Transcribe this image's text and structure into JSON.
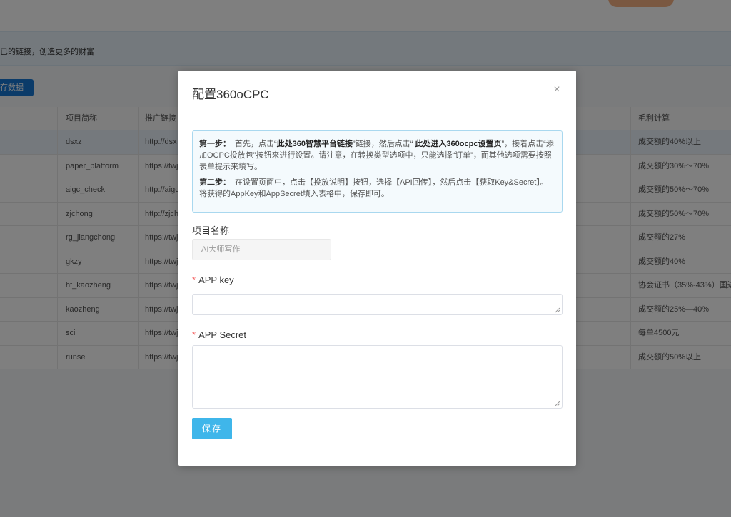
{
  "background": {
    "banner_text": "已的链接，创造更多的财富",
    "save_data_label": "存数据",
    "table": {
      "headers": [
        "项目简称",
        "推广链接",
        "毛利计算"
      ],
      "rows": [
        {
          "name": "dsxz",
          "link": "http://dsx",
          "profit": "成交额的40%以上"
        },
        {
          "name": "paper_platform",
          "link": "https://twj",
          "profit": "成交额的30%～70%"
        },
        {
          "name": "aigc_check",
          "link": "http://aigc",
          "profit": "成交额的50%～70%"
        },
        {
          "name": "zjchong",
          "link": "http://zjch",
          "profit": "成交额的50%～70%"
        },
        {
          "name": "rg_jiangchong",
          "link": "https://twj",
          "profit": "成交额的27%"
        },
        {
          "name": "gkzy",
          "link": "https://twj",
          "profit": "成交额的40%"
        },
        {
          "name": "ht_kaozheng",
          "link": "https://twj",
          "profit": "协会证书（35%-43%）国进"
        },
        {
          "name": "kaozheng",
          "link": "https://twj",
          "profit": "成交额的25%—40%"
        },
        {
          "name": "sci",
          "link": "https://twj",
          "profit": "每单4500元"
        },
        {
          "name": "runse",
          "link": "https://twj",
          "profit": "成交额的50%以上"
        }
      ]
    }
  },
  "modal": {
    "title": "配置360oCPC",
    "close_icon": "×",
    "notice": {
      "step1_label": "第一步：",
      "step1_a": "首先，点击“",
      "step1_link1": "此处360智慧平台链接",
      "step1_b": "”链接，然后点击“ ",
      "step1_link2": "此处进入360ocpc设置页",
      "step1_c": "”，接着点击“添加OCPC投放包”按钮来进行设置。请注意，在转换类型选项中，只能选择“订单”，而其他选项需要按照表单提示来填写。",
      "step2_label": "第二步：",
      "step2_text": "在设置页面中，点击【投放说明】按钮，选择【API回传】，然后点击【获取Key&Secret】。将获得的AppKey和AppSecret填入表格中，保存即可。"
    },
    "project_name_label": "项目名称",
    "project_name_value": "AI大师写作",
    "app_key_label": "APP key",
    "app_key_value": "",
    "app_secret_label": "APP Secret",
    "app_secret_value": "",
    "required_mark": "*",
    "save_label": "保存"
  }
}
